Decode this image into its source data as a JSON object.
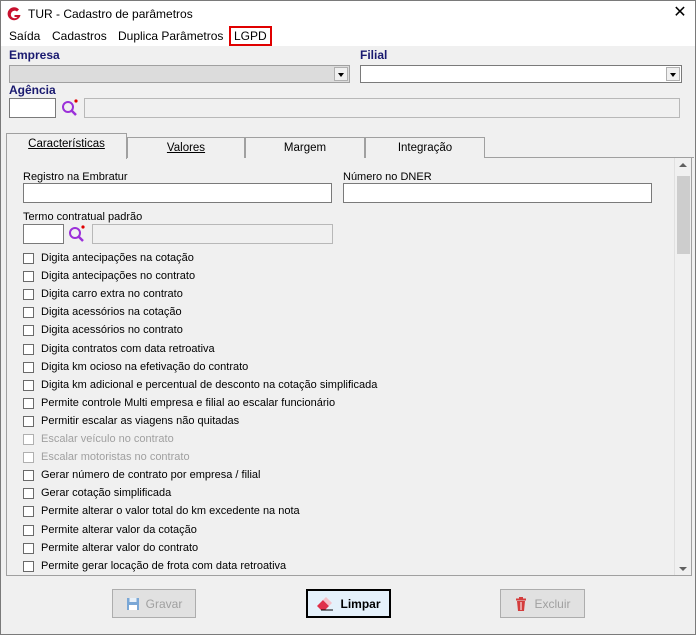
{
  "window": {
    "title": "TUR - Cadastro de parâmetros",
    "close_glyph": "✕"
  },
  "menu": {
    "items": [
      "Saída",
      "Cadastros",
      "Duplica Parâmetros",
      "LGPD"
    ]
  },
  "filters": {
    "empresa_label": "Empresa",
    "empresa_value": "",
    "filial_label": "Filial",
    "filial_value": "",
    "agencia_label": "Agência",
    "agencia_code": "",
    "agencia_name": ""
  },
  "tabs": [
    "Características",
    "Valores",
    "Margem",
    "Integração"
  ],
  "characteristics": {
    "registro_label": "Registro na Embratur",
    "registro_value": "",
    "dner_label": "Número no DNER",
    "dner_value": "",
    "termo_label": "Termo contratual padrão",
    "termo_code": "",
    "termo_desc": "",
    "checkboxes": [
      {
        "label": "Digita antecipações na cotação",
        "checked": false,
        "enabled": true
      },
      {
        "label": "Digita antecipações no contrato",
        "checked": false,
        "enabled": true
      },
      {
        "label": "Digita carro extra no contrato",
        "checked": false,
        "enabled": true
      },
      {
        "label": "Digita acessórios na cotação",
        "checked": false,
        "enabled": true
      },
      {
        "label": "Digita acessórios no contrato",
        "checked": false,
        "enabled": true
      },
      {
        "label": "Digita contratos com data retroativa",
        "checked": false,
        "enabled": true
      },
      {
        "label": "Digita km ocioso na efetivação do contrato",
        "checked": false,
        "enabled": true
      },
      {
        "label": "Digita km adicional e percentual de desconto na cotação simplificada",
        "checked": false,
        "enabled": true
      },
      {
        "label": "Permite controle Multi empresa e filial ao escalar funcionário",
        "checked": false,
        "enabled": true
      },
      {
        "label": "Permitir escalar as viagens não quitadas",
        "checked": false,
        "enabled": true
      },
      {
        "label": "Escalar veículo no contrato",
        "checked": false,
        "enabled": false
      },
      {
        "label": "Escalar motoristas no contrato",
        "checked": false,
        "enabled": false
      },
      {
        "label": "Gerar número de contrato por empresa / filial",
        "checked": false,
        "enabled": true
      },
      {
        "label": "Gerar cotação simplificada",
        "checked": false,
        "enabled": true
      },
      {
        "label": "Permite alterar o valor total do km excedente na nota",
        "checked": false,
        "enabled": true
      },
      {
        "label": "Permite alterar valor da cotação",
        "checked": false,
        "enabled": true
      },
      {
        "label": "Permite alterar valor do contrato",
        "checked": false,
        "enabled": true
      },
      {
        "label": "Permite gerar locação de frota com data retroativa",
        "checked": false,
        "enabled": true
      }
    ]
  },
  "buttons": {
    "save": "Gravar",
    "clear": "Limpar",
    "delete": "Excluir"
  },
  "colors": {
    "accent_red": "#e00000",
    "brand_red": "#c8102e",
    "search_purple": "#9b30d9"
  }
}
